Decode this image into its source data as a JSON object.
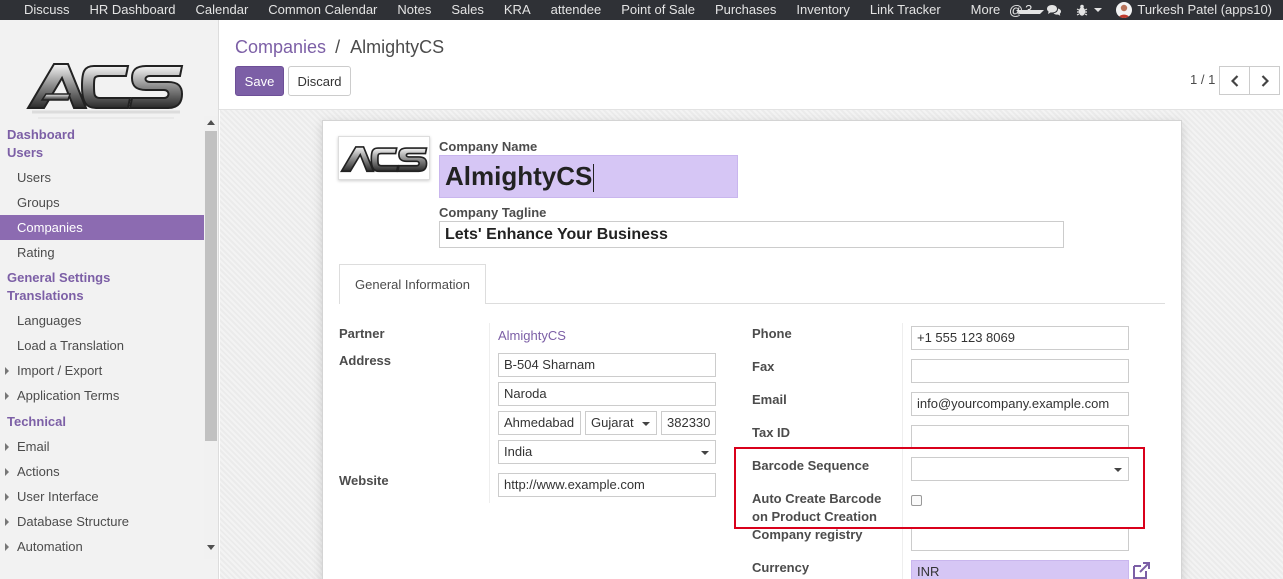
{
  "topnav": {
    "items": [
      "Discuss",
      "HR Dashboard",
      "Calendar",
      "Common Calendar",
      "Notes",
      "Sales",
      "KRA",
      "attendee",
      "Point of Sale",
      "Purchases",
      "Inventory",
      "Link Tracker"
    ],
    "more": "More",
    "mention_count": "3",
    "user": "Turkesh Patel (apps10)"
  },
  "sidebar": {
    "logo_text": "ACS",
    "sections": {
      "dashboard": "Dashboard",
      "users": "Users",
      "users_items": [
        "Users",
        "Groups",
        "Companies",
        "Rating"
      ],
      "general_settings": "General Settings",
      "translations": "Translations",
      "translations_items": [
        "Languages",
        "Load a Translation",
        "Import / Export",
        "Application Terms"
      ],
      "technical": "Technical",
      "technical_items": [
        "Email",
        "Actions",
        "User Interface",
        "Database Structure",
        "Automation"
      ]
    }
  },
  "control_panel": {
    "breadcrumb_parent": "Companies",
    "breadcrumb_sep": "/",
    "breadcrumb_current": "AlmightyCS",
    "save_label": "Save",
    "discard_label": "Discard",
    "pager": "1 / 1"
  },
  "form": {
    "company_name_label": "Company Name",
    "company_name": "AlmightyCS",
    "tagline_label": "Company Tagline",
    "tagline": "Lets' Enhance Your Business",
    "tab_general": "General Information",
    "left": {
      "partner_label": "Partner",
      "partner": "AlmightyCS",
      "address_label": "Address",
      "street": "B-504 Sharnam",
      "street2": "Naroda",
      "city": "Ahmedabad",
      "state": "Gujarat",
      "zip": "382330",
      "country": "India",
      "website_label": "Website",
      "website": "http://www.example.com"
    },
    "right": {
      "phone_label": "Phone",
      "phone": "+1 555 123 8069",
      "fax_label": "Fax",
      "fax": "",
      "email_label": "Email",
      "email": "info@yourcompany.example.com",
      "taxid_label": "Tax ID",
      "taxid": "",
      "barcode_seq_label": "Barcode Sequence",
      "barcode_seq": "",
      "auto_barcode_label_1": "Auto Create Barcode",
      "auto_barcode_label_2": "on Product Creation",
      "company_registry_label": "Company registry",
      "company_registry": "",
      "currency_label": "Currency",
      "currency": "INR"
    }
  },
  "colors": {
    "accent": "#7c5fa6",
    "active_menu": "#8c6bb1",
    "required_field": "#d6c6f5",
    "navbar": "#2f3136",
    "highlight": "#d9001b"
  }
}
